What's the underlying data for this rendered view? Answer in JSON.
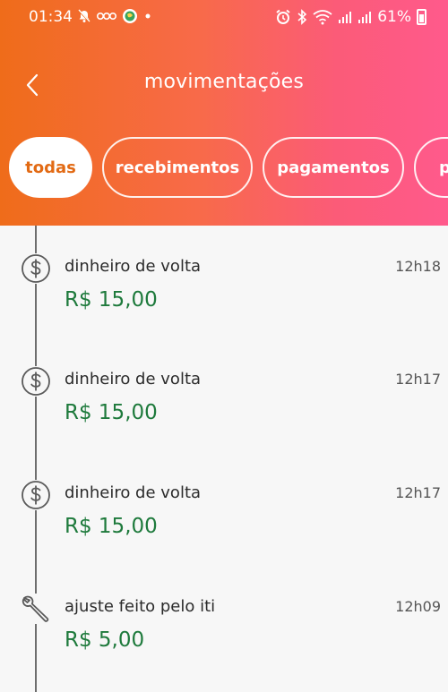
{
  "status_bar": {
    "time": "01:34",
    "battery": "61%"
  },
  "header": {
    "title": "movimentações"
  },
  "tabs": [
    {
      "label": "todas"
    },
    {
      "label": "recebimentos"
    },
    {
      "label": "pagamentos"
    },
    {
      "label": "p"
    }
  ],
  "entries": [
    {
      "icon": "dollar-coin-icon",
      "title": "dinheiro de volta",
      "time": "12h18",
      "amount": "R$ 15,00"
    },
    {
      "icon": "dollar-coin-icon",
      "title": "dinheiro de volta",
      "time": "12h17",
      "amount": "R$ 15,00"
    },
    {
      "icon": "dollar-coin-icon",
      "title": "dinheiro de volta",
      "time": "12h17",
      "amount": "R$ 15,00"
    },
    {
      "icon": "wrench-icon",
      "title": "ajuste feito pelo iti",
      "time": "12h09",
      "amount": "R$ 5,00"
    }
  ],
  "colors": {
    "header_gradient_start": "#ef6c1a",
    "header_gradient_end": "#ff5a8c",
    "amount": "#1e7a3c",
    "active_tab_text": "#e26a14"
  }
}
